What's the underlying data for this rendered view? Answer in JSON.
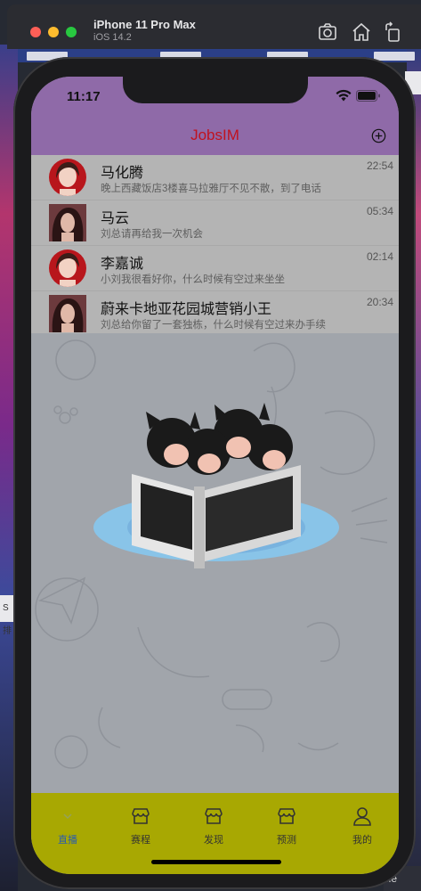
{
  "simulator": {
    "device_name": "iPhone 11 Pro Max",
    "os_version": "iOS 14.2"
  },
  "status_bar": {
    "time": "11:17"
  },
  "nav": {
    "title": "JobsIM"
  },
  "chats": [
    {
      "name": "马化腾",
      "preview": "晚上西藏饭店3楼喜马拉雅厅不见不散，到了电话",
      "time": "22:54",
      "avatar": "woman-red-round"
    },
    {
      "name": "马云",
      "preview": "刘总请再给我一次机会",
      "time": "05:34",
      "avatar": "woman-dark-square"
    },
    {
      "name": "李嘉诚",
      "preview": "小刘我很看好你，什么时候有空过来坐坐",
      "time": "02:14",
      "avatar": "woman-red-round"
    },
    {
      "name": "蔚来卡地亚花园城营销小王",
      "preview": "刘总给你留了一套独栋，什么时候有空过来办手续",
      "time": "20:34",
      "avatar": "woman-dark-square"
    }
  ],
  "tabs": [
    {
      "label": "直播",
      "icon": "live-icon",
      "active": true
    },
    {
      "label": "赛程",
      "icon": "store-icon",
      "active": false
    },
    {
      "label": "发现",
      "icon": "store-icon",
      "active": false
    },
    {
      "label": "预测",
      "icon": "store-icon",
      "active": false
    },
    {
      "label": "我的",
      "icon": "person-icon",
      "active": false
    }
  ],
  "desktop_fragments": {
    "left_label": "S排",
    "bottom_right_label": "ile"
  },
  "colors": {
    "nav_bg": "#8f6aa8",
    "title_red": "#c1121f",
    "tab_bar_bg": "#a8a802",
    "active_tab": "#2a5db0"
  }
}
